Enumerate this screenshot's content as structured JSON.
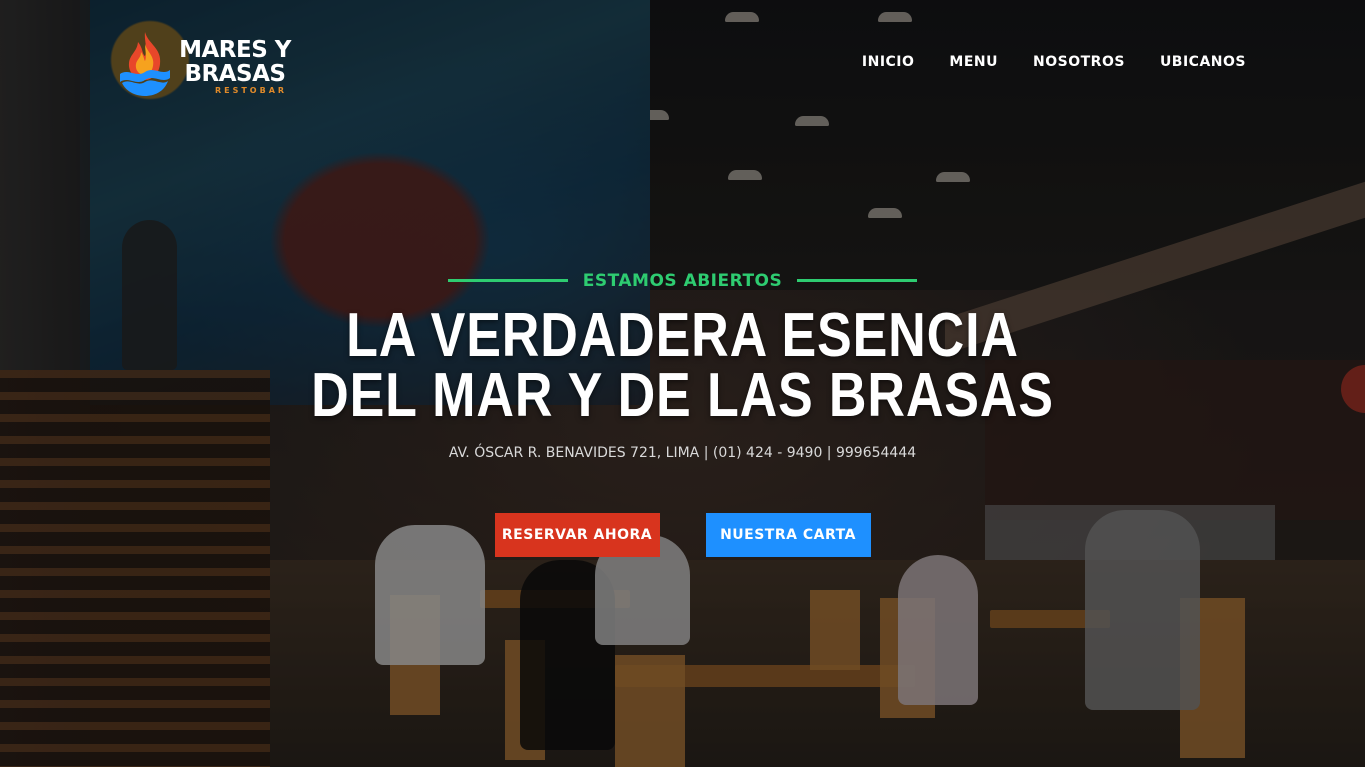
{
  "brand": {
    "name_line1": "MARES Y",
    "name_line2": "BRASAS",
    "tagline": "RESTOBAR",
    "accent_orange": "#e08a2a",
    "accent_blue": "#1e90ff"
  },
  "nav": {
    "items": [
      {
        "label": "INICIO"
      },
      {
        "label": "MENU"
      },
      {
        "label": "NOSOTROS"
      },
      {
        "label": "UBICANOS"
      }
    ]
  },
  "hero": {
    "eyebrow": "ESTAMOS ABIERTOS",
    "title_line1": "LA VERDADERA ESENCIA",
    "title_line2": "DEL MAR Y DE LAS BRASAS",
    "address": "AV. ÓSCAR R. BENAVIDES 721, LIMA | (01) 424 - 9490 | 999654444",
    "eyebrow_color": "#2ecc71",
    "primary_button": {
      "label": "RESERVAR AHORA",
      "color": "#d8341e"
    },
    "secondary_button": {
      "label": "NUESTRA CARTA",
      "color": "#1e90ff"
    }
  },
  "background_photo": {
    "icon": "restaurant-interior-photo"
  }
}
